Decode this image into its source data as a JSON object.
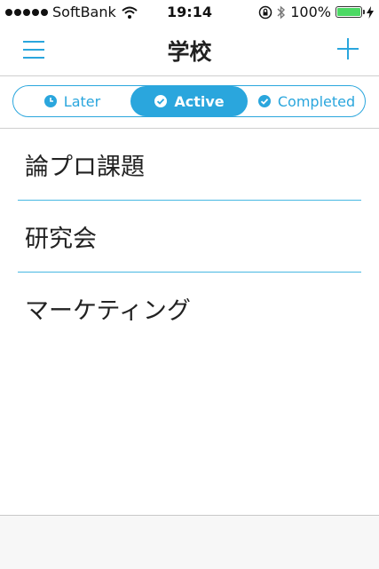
{
  "status_bar": {
    "carrier": "SoftBank",
    "time": "19:14",
    "battery": "100%",
    "battery_level": 1.0,
    "icons": [
      "signal-dots-icon",
      "wifi-icon",
      "orientation-lock-icon",
      "bluetooth-icon",
      "battery-icon",
      "charging-icon"
    ]
  },
  "nav": {
    "title": "学校",
    "left_icon": "menu-icon",
    "right_icon": "add-icon"
  },
  "tabs": [
    {
      "label": "Later",
      "icon": "clock-icon",
      "active": false
    },
    {
      "label": "Active",
      "icon": "check-circle-icon",
      "active": true
    },
    {
      "label": "Completed",
      "icon": "check-circle-icon",
      "active": false
    }
  ],
  "list": {
    "items": [
      "論プロ課題",
      "研究会",
      "マーケティング"
    ]
  },
  "colors": {
    "accent": "#2aa6dd",
    "divider": "#47b8e2",
    "battery": "#4cd964"
  }
}
